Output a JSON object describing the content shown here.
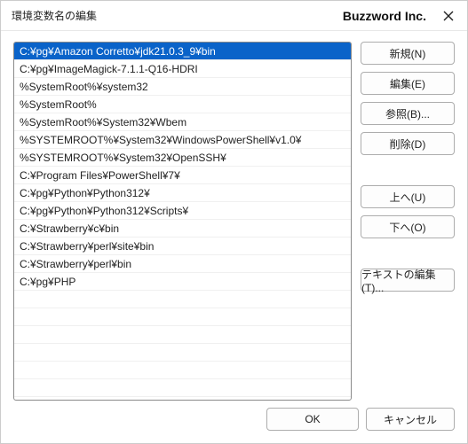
{
  "titlebar": {
    "title": "環境変数名の編集",
    "brand": "Buzzword Inc."
  },
  "list": {
    "selected_index": 0,
    "items": [
      "C:¥pg¥Amazon Corretto¥jdk21.0.3_9¥bin",
      "C:¥pg¥ImageMagick-7.1.1-Q16-HDRI",
      "%SystemRoot%¥system32",
      "%SystemRoot%",
      "%SystemRoot%¥System32¥Wbem",
      "%SYSTEMROOT%¥System32¥WindowsPowerShell¥v1.0¥",
      "%SYSTEMROOT%¥System32¥OpenSSH¥",
      "C:¥Program Files¥PowerShell¥7¥",
      "C:¥pg¥Python¥Python312¥",
      "C:¥pg¥Python¥Python312¥Scripts¥",
      "C:¥Strawberry¥c¥bin",
      "C:¥Strawberry¥perl¥site¥bin",
      "C:¥Strawberry¥perl¥bin",
      "C:¥pg¥PHP"
    ]
  },
  "buttons": {
    "new": "新規(N)",
    "edit": "編集(E)",
    "browse": "参照(B)...",
    "delete": "削除(D)",
    "up": "上へ(U)",
    "down": "下へ(O)",
    "edit_text": "テキストの編集(T)...",
    "ok": "OK",
    "cancel": "キャンセル"
  }
}
